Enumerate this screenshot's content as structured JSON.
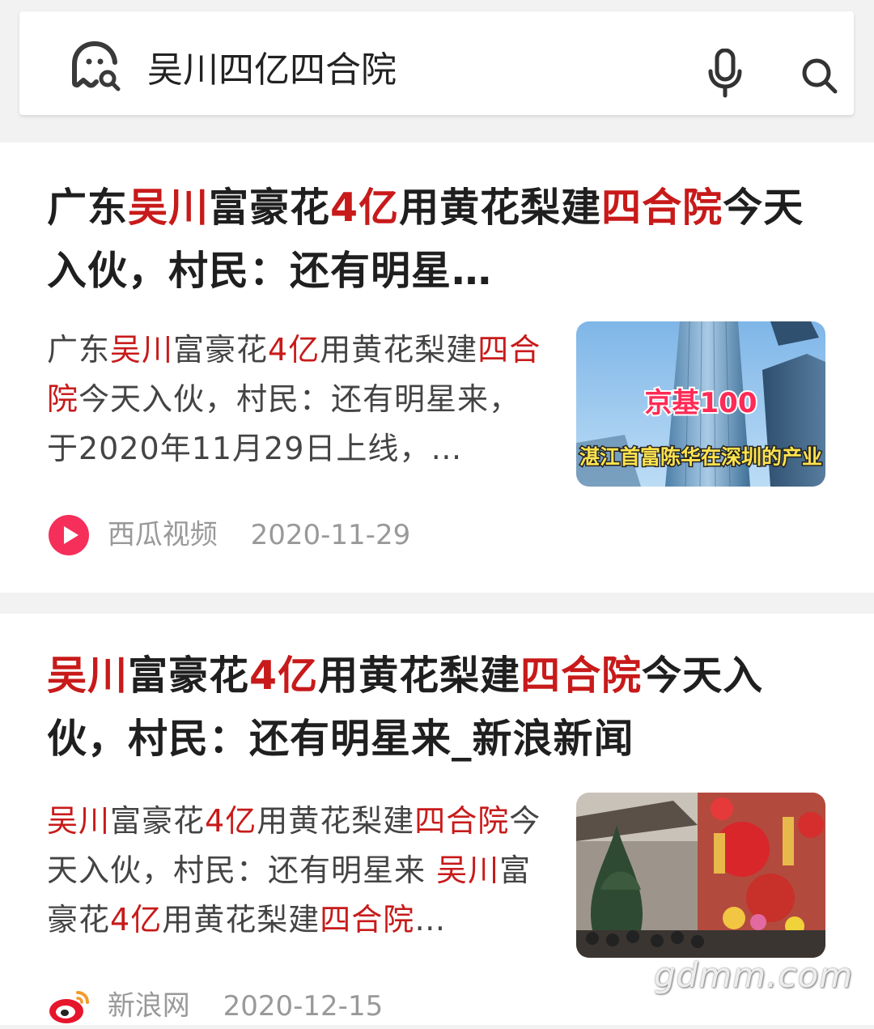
{
  "search": {
    "query": "吴川四亿四合院",
    "logo_icon": "ghost-search-icon",
    "mic_icon": "microphone-icon",
    "search_icon": "search-icon"
  },
  "results": [
    {
      "title_parts": [
        {
          "text": "广东",
          "hl": false
        },
        {
          "text": "吴川",
          "hl": true
        },
        {
          "text": "富豪花",
          "hl": false
        },
        {
          "text": "4亿",
          "hl": true
        },
        {
          "text": "用黄花梨建",
          "hl": false
        },
        {
          "text": "四合院",
          "hl": true
        },
        {
          "text": "今天入伙，村民：还有明星…",
          "hl": false
        }
      ],
      "snippet_parts": [
        {
          "text": "广东",
          "hl": false
        },
        {
          "text": "吴川",
          "hl": true
        },
        {
          "text": "富豪花",
          "hl": false
        },
        {
          "text": "4亿",
          "hl": true
        },
        {
          "text": "用黄花梨建",
          "hl": false
        },
        {
          "text": "四合院",
          "hl": true
        },
        {
          "text": "今天入伙，村民：还有明星来，于2020年11月29日上线，…",
          "hl": false
        }
      ],
      "thumbnail": {
        "label_top": "京基100",
        "label_bottom": "湛江首富陈华在深圳的产业"
      },
      "source": {
        "name": "西瓜视频",
        "date": "2020-11-29",
        "icon": "xigua-video-icon"
      }
    },
    {
      "title_parts": [
        {
          "text": "吴川",
          "hl": true
        },
        {
          "text": "富豪花",
          "hl": false
        },
        {
          "text": "4亿",
          "hl": true
        },
        {
          "text": "用黄花梨建",
          "hl": false
        },
        {
          "text": "四合院",
          "hl": true
        },
        {
          "text": "今天入伙，村民：还有明星来_新浪新闻",
          "hl": false
        }
      ],
      "snippet_parts": [
        {
          "text": "吴川",
          "hl": true
        },
        {
          "text": "富豪花",
          "hl": false
        },
        {
          "text": "4亿",
          "hl": true
        },
        {
          "text": "用黄花梨建",
          "hl": false
        },
        {
          "text": "四合院",
          "hl": true
        },
        {
          "text": "今天入伙，村民：还有明星来 ",
          "hl": false
        },
        {
          "text": "吴川",
          "hl": true
        },
        {
          "text": "富豪花",
          "hl": false
        },
        {
          "text": "4亿",
          "hl": true
        },
        {
          "text": "用黄花梨建",
          "hl": false
        },
        {
          "text": "四合院",
          "hl": true
        },
        {
          "text": "…",
          "hl": false
        }
      ],
      "thumbnail": {},
      "source": {
        "name": "新浪网",
        "date": "2020-12-15",
        "icon": "sina-weibo-icon"
      }
    }
  ],
  "watermark": "gdmm.com",
  "colors": {
    "highlight": "#c81a1a",
    "text": "#222222",
    "meta": "#999999"
  }
}
